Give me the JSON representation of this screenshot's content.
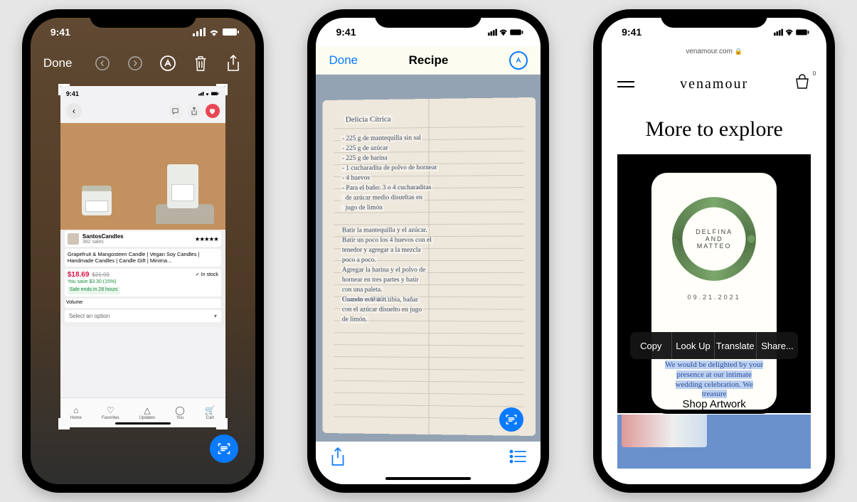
{
  "status_time": "9:41",
  "phone1": {
    "toolbar": {
      "done": "Done"
    },
    "mini": {
      "time": "9:41",
      "seller_name": "SantosCandles",
      "seller_sales": "382 sales",
      "rating": "★★★★★",
      "title": "Grapefruit & Mangosteen Candle | Vegan Soy Candles | Handmade Candles | Candle Gift | Minima...",
      "price": "$18.69",
      "price_old": "$21.99",
      "stock": "✓ In stock",
      "save": "You save $3.30 (15%)",
      "sale_ends": "Sale ends in 28 hours",
      "volume_label": "Volume",
      "select_placeholder": "Select an option",
      "tabs": {
        "home": "Home",
        "favorites": "Favorites",
        "updates": "Updates",
        "you": "You",
        "cart": "Cart"
      }
    }
  },
  "phone2": {
    "toolbar": {
      "done": "Done",
      "title": "Recipe"
    },
    "note_title": "Delicia Cítrica",
    "ingredients": "- 225 g de mantequilla sin sal\n- 225 g de azúcar\n- 225 g de harina\n- 1 cucharadita de polvo de hornear\n- 4 huevos\n- Para el baño: 3 o 4 cucharaditas\n  de azúcar medio disueltas en\n  jugo de limón",
    "steps": "Batir la mantequilla y el azúcar.\nBatir un poco los 4 huevos con el\ntenedor y agregar a la mezcla\npoco a poco.\nAgregar la harina y el polvo de\nhornear en tres partes y batir\ncon una paleta.\nHornear a 180 °C.",
    "finish": "Cuando esté aún tibia, bañar\ncon el azúcar disuelto en jugo\nde limón."
  },
  "phone3": {
    "url": "venamour.com",
    "brand": "venamour",
    "cart_count": "0",
    "heading": "More to explore",
    "invite_line1": "DELFINA",
    "invite_and": "AND",
    "invite_line2": "MATTEO",
    "invite_date": "09.21.2021",
    "selected_text": "We would be delighted by your presence at our intimate wedding celebration. We treasure",
    "menu": {
      "copy": "Copy",
      "lookup": "Look Up",
      "translate": "Translate",
      "share": "Share..."
    },
    "shop": "Shop Artwork"
  }
}
